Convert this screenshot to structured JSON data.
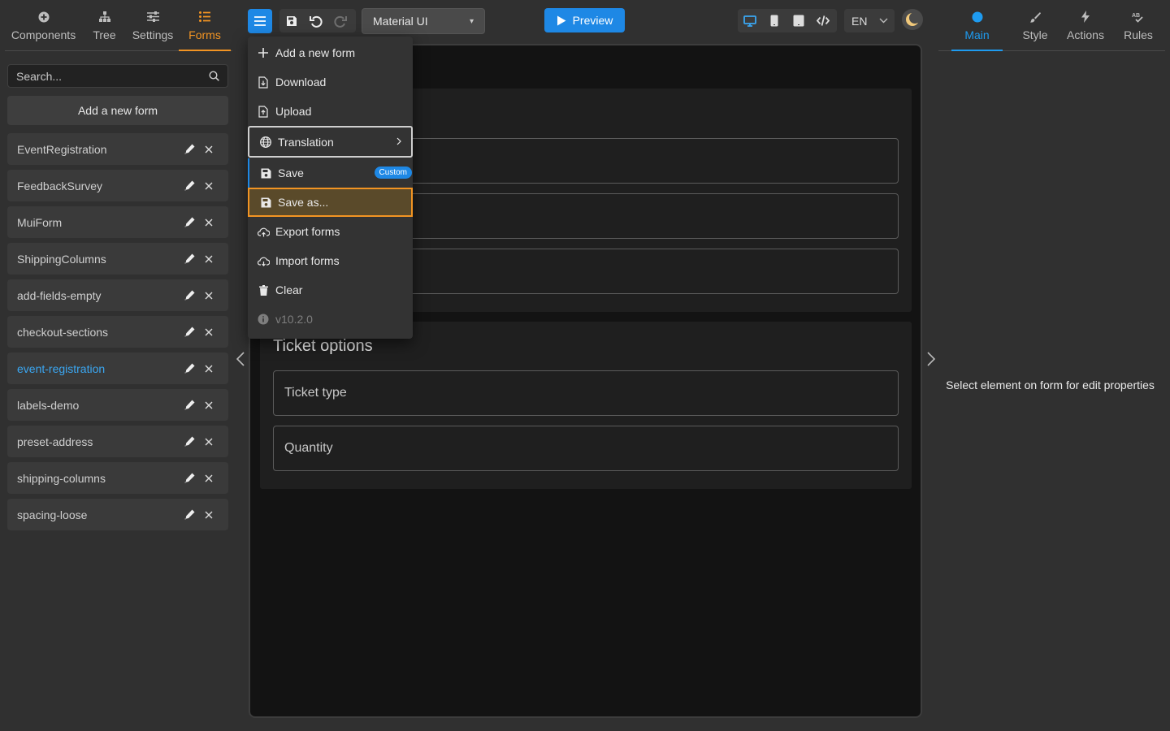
{
  "left_tabs": [
    {
      "label": "Components",
      "icon": "plus-circle-icon"
    },
    {
      "label": "Tree",
      "icon": "sitemap-icon"
    },
    {
      "label": "Settings",
      "icon": "sliders-icon"
    },
    {
      "label": "Forms",
      "icon": "list-icon",
      "active": true
    }
  ],
  "search": {
    "placeholder": "Search..."
  },
  "add_form_label": "Add a new form",
  "forms": [
    {
      "name": "EventRegistration"
    },
    {
      "name": "FeedbackSurvey"
    },
    {
      "name": "MuiForm"
    },
    {
      "name": "ShippingColumns"
    },
    {
      "name": "add-fields-empty"
    },
    {
      "name": "checkout-sections"
    },
    {
      "name": "event-registration",
      "active": true
    },
    {
      "name": "labels-demo"
    },
    {
      "name": "preset-address"
    },
    {
      "name": "shipping-columns"
    },
    {
      "name": "spacing-loose"
    }
  ],
  "toolbar": {
    "theme_value": "Material UI",
    "preview_label": "Preview",
    "language": "EN"
  },
  "menu": {
    "add_new_form": "Add a new form",
    "download": "Download",
    "upload": "Upload",
    "translation": "Translation",
    "save": "Save",
    "save_badge": "Custom",
    "save_as": "Save as...",
    "export_forms": "Export forms",
    "import_forms": "Import forms",
    "clear": "Clear",
    "version": "v10.2.0"
  },
  "canvas": {
    "section2_title": "Ticket options",
    "field_ticket_type": "Ticket type",
    "field_quantity": "Quantity"
  },
  "right_tabs": [
    {
      "label": "Main",
      "icon": "circle-icon",
      "active": true
    },
    {
      "label": "Style",
      "icon": "brush-icon"
    },
    {
      "label": "Actions",
      "icon": "bolt-icon"
    },
    {
      "label": "Rules",
      "icon": "spellcheck-icon"
    }
  ],
  "right_message": "Select element on form for edit properties",
  "colors": {
    "accent_orange": "#f29423",
    "accent_blue": "#1e88e5",
    "active_link": "#3aa7f2",
    "background": "#303030"
  }
}
